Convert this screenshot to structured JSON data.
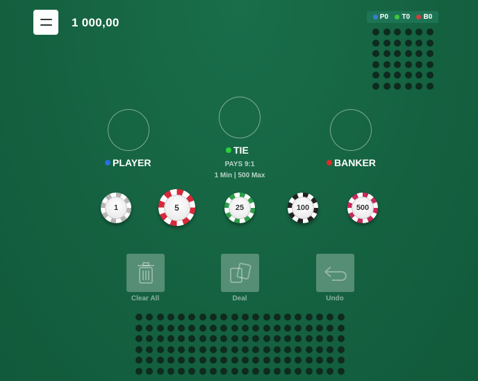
{
  "header": {
    "balance": "1 000,00"
  },
  "history": {
    "player": {
      "label": "P0",
      "color": "#3a7bd5"
    },
    "tie": {
      "label": "T0",
      "color": "#3ec73a"
    },
    "banker": {
      "label": "B0",
      "color": "#d63a3a"
    }
  },
  "bets": {
    "player": {
      "label": "PLAYER",
      "color": "#2a6fe0"
    },
    "tie": {
      "label": "TIE",
      "color": "#2dd13a",
      "pays": "PAYS 9:1",
      "limits": "1 Min | 500 Max"
    },
    "banker": {
      "label": "BANKER",
      "color": "#e02a2a"
    }
  },
  "chips": [
    {
      "value": "1",
      "color": "#c9c9c9"
    },
    {
      "value": "5",
      "color": "#d8283a"
    },
    {
      "value": "25",
      "color": "#2f9e4a"
    },
    {
      "value": "100",
      "color": "#222222"
    },
    {
      "value": "500",
      "color": "#c8285a"
    }
  ],
  "actions": {
    "clear": "Clear All",
    "deal": "Deal",
    "undo": "Undo"
  }
}
